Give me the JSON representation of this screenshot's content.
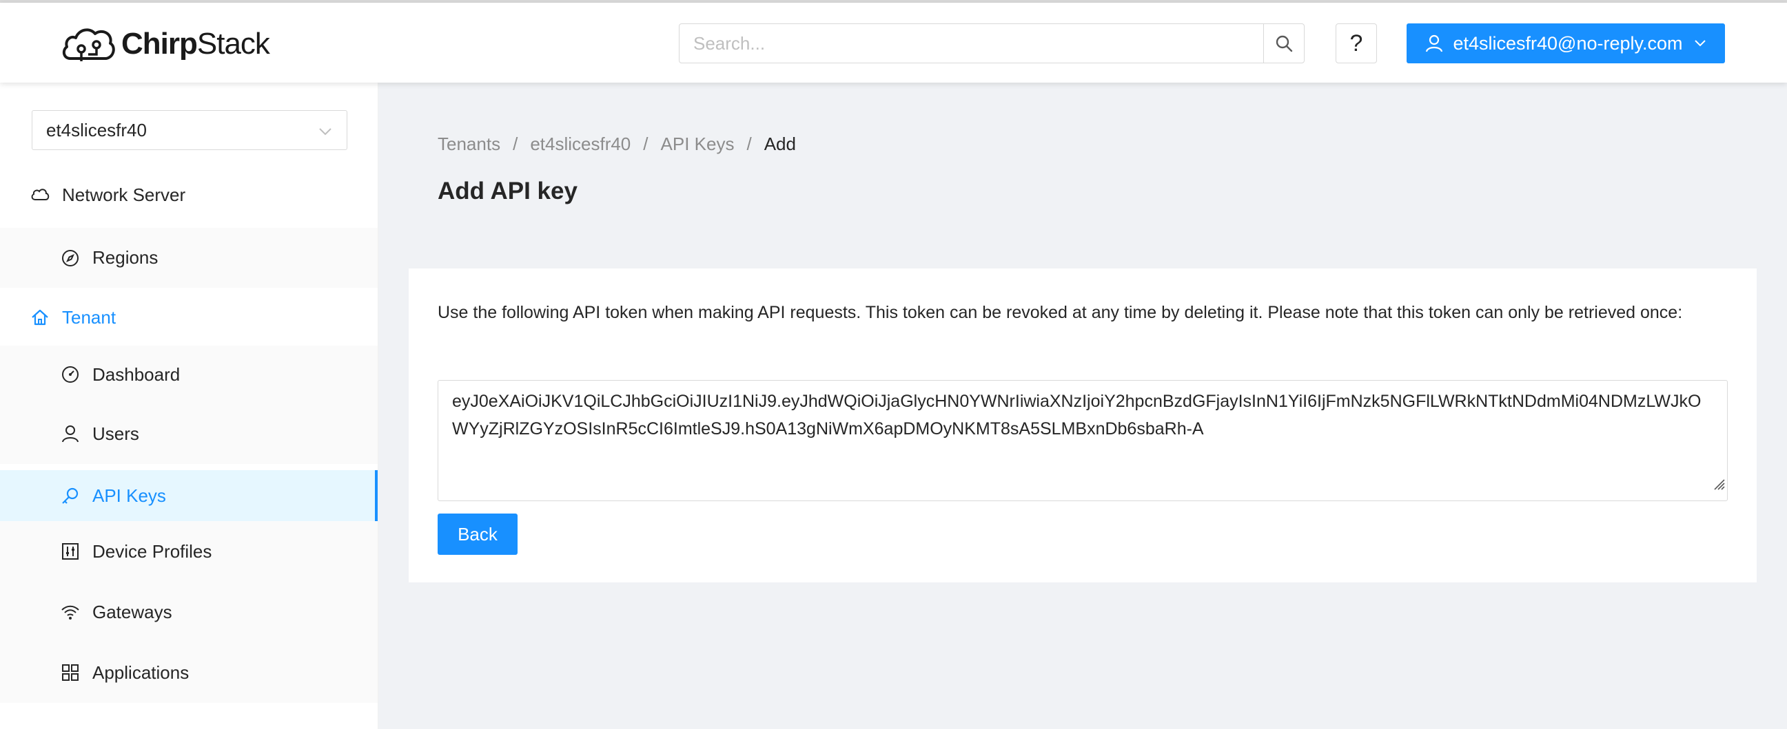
{
  "header": {
    "logo_text_bold": "Chirp",
    "logo_text_regular": "Stack",
    "search_placeholder": "Search...",
    "help_label": "?",
    "user_email": "et4slicesfr40@no-reply.com"
  },
  "sidebar": {
    "tenant_selected": "et4slicesfr40",
    "items": [
      {
        "label": "Network Server",
        "icon": "cloud-icon"
      },
      {
        "label": "Regions",
        "icon": "compass-icon"
      },
      {
        "label": "Tenant",
        "icon": "home-icon"
      },
      {
        "label": "Dashboard",
        "icon": "dashboard-icon"
      },
      {
        "label": "Users",
        "icon": "user-icon"
      },
      {
        "label": "API Keys",
        "icon": "key-icon"
      },
      {
        "label": "Device Profiles",
        "icon": "sliders-icon"
      },
      {
        "label": "Gateways",
        "icon": "wifi-icon"
      },
      {
        "label": "Applications",
        "icon": "grid-icon"
      }
    ]
  },
  "breadcrumb": [
    "Tenants",
    "et4slicesfr40",
    "API Keys",
    "Add"
  ],
  "page": {
    "title": "Add API key",
    "description": "Use the following API token when making API requests. This token can be revoked at any time by deleting it. Please note that this token can only be retrieved once:",
    "token": "eyJ0eXAiOiJKV1QiLCJhbGciOiJIUzI1NiJ9.eyJhdWQiOiJjaGlycHN0YWNrIiwiaXNzIjoiY2hpcnBzdGFjayIsInN1YiI6IjFmNzk5NGFlLWRkNTktNDdmMi04NDMzLWJkOWYyZjRlZGYzOSIsInR5cCI6ImtleSJ9.hS0A13gNiWmX6apDMOyNKMT8sA5SLMBxnDb6sbaRh-A",
    "back_label": "Back"
  },
  "colors": {
    "primary": "#1890ff",
    "background": "#f0f2f5",
    "selected_bg": "#e6f7ff"
  }
}
